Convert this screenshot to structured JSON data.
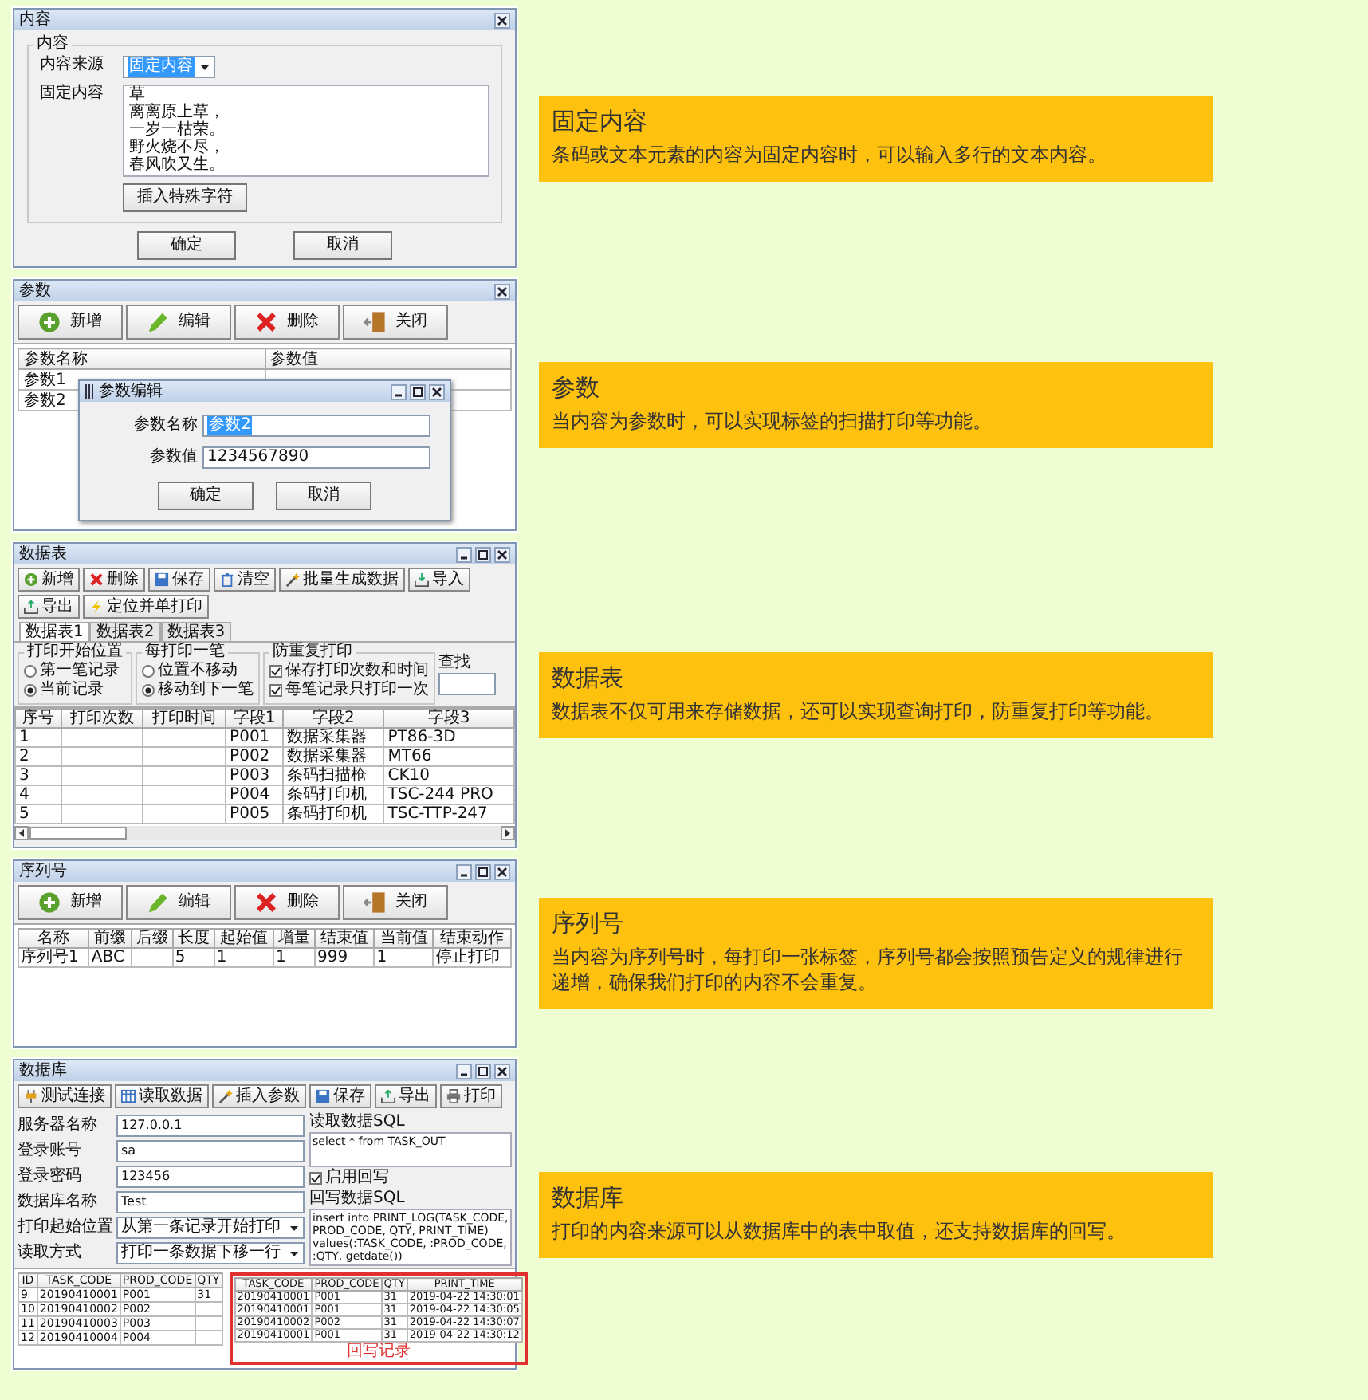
{
  "sections": [
    {
      "kind": "content",
      "window": {
        "title": "内容",
        "resizable": false,
        "group": "内容",
        "source_label": "内容来源",
        "source": {
          "value": "固定内容",
          "selected": true
        },
        "fixed_label": "固定内容",
        "lines": [
          "草",
          "离离原上草，",
          "一岁一枯荣。",
          "野火烧不尽，",
          "春风吹又生。"
        ],
        "insert_button": "插入特殊字符",
        "buttons": [
          "确定",
          "取消"
        ]
      },
      "info": {
        "title": "固定内容",
        "text": "条码或文本元素的内容为固定内容时，可以输入多行的文本内容。"
      }
    },
    {
      "kind": "params",
      "window": {
        "title": "参数",
        "resizable": false,
        "toolbar": [
          {
            "label": "新增",
            "kind": "add"
          },
          {
            "label": "编辑",
            "kind": "edit"
          },
          {
            "label": "删除",
            "kind": "delete"
          },
          {
            "label": "关闭",
            "kind": "close"
          }
        ],
        "columns": [
          "参数名称",
          "参数值"
        ],
        "rows": [
          [
            "参数1",
            ""
          ],
          [
            "参数2",
            ""
          ]
        ],
        "dialog": {
          "title": "参数编辑",
          "fields": [
            {
              "label": "参数名称",
              "value": "参数2",
              "selected": true
            },
            {
              "label": "参数值",
              "value": "1234567890",
              "selected": false
            }
          ],
          "buttons": [
            "确定",
            "取消"
          ]
        }
      },
      "info": {
        "title": "参数",
        "text": "当内容为参数时，可以实现标签的扫描打印等功能。"
      }
    },
    {
      "kind": "datatable",
      "window": {
        "title": "数据表",
        "resizable": true,
        "toolbar": [
          {
            "label": "新增",
            "kind": "add"
          },
          {
            "label": "删除",
            "kind": "delete"
          },
          {
            "label": "保存",
            "kind": "save"
          },
          {
            "label": "清空",
            "kind": "clear"
          },
          {
            "label": "批量生成数据",
            "kind": "generate"
          },
          {
            "label": "导入",
            "kind": "import"
          },
          {
            "label": "导出",
            "kind": "export"
          },
          {
            "label": "定位并单打印",
            "kind": "print"
          }
        ],
        "tabs": [
          {
            "label": "数据表1",
            "selected": true
          },
          {
            "label": "数据表2",
            "selected": false
          },
          {
            "label": "数据表3",
            "selected": false
          }
        ],
        "groups": [
          {
            "title": "打印开始位置",
            "options": [
              {
                "kind": "radio",
                "label": "第一笔记录",
                "checked": false
              },
              {
                "kind": "radio",
                "label": "当前记录",
                "checked": true
              }
            ]
          },
          {
            "title": "每打印一笔",
            "options": [
              {
                "kind": "radio",
                "label": "位置不移动",
                "checked": false
              },
              {
                "kind": "radio",
                "label": "移动到下一笔",
                "checked": true
              }
            ]
          },
          {
            "title": "防重复打印",
            "options": [
              {
                "kind": "checkbox",
                "label": "保存打印次数和时间",
                "checked": true
              },
              {
                "kind": "checkbox",
                "label": "每笔记录只打印一次",
                "checked": true
              }
            ]
          }
        ],
        "search_label": "查找",
        "columns": [
          "序号",
          "打印次数",
          "打印时间",
          "字段1",
          "字段2",
          "字段3"
        ],
        "rows": [
          [
            "1",
            "",
            "",
            "P001",
            "数据采集器",
            "PT86-3D"
          ],
          [
            "2",
            "",
            "",
            "P002",
            "数据采集器",
            "MT66"
          ],
          [
            "3",
            "",
            "",
            "P003",
            "条码扫描枪",
            "CK10"
          ],
          [
            "4",
            "",
            "",
            "P004",
            "条码打印机",
            "TSC-244 PRO"
          ],
          [
            "5",
            "",
            "",
            "P005",
            "条码打印机",
            "TSC-TTP-247"
          ]
        ]
      },
      "info": {
        "title": "数据表",
        "text": "数据表不仅可用来存储数据，还可以实现查询打印，防重复打印等功能。"
      }
    },
    {
      "kind": "serial",
      "window": {
        "title": "序列号",
        "resizable": true,
        "toolbar": [
          {
            "label": "新增",
            "kind": "add"
          },
          {
            "label": "编辑",
            "kind": "edit"
          },
          {
            "label": "删除",
            "kind": "delete"
          },
          {
            "label": "关闭",
            "kind": "close"
          }
        ],
        "columns": [
          "名称",
          "前缀",
          "后缀",
          "长度",
          "起始值",
          "增量",
          "结束值",
          "当前值",
          "结束动作"
        ],
        "rows": [
          [
            "序列号1",
            "ABC",
            "",
            "5",
            "1",
            "1",
            "999",
            "1",
            "停止打印"
          ]
        ]
      },
      "info": {
        "title": "序列号",
        "text": "当内容为序列号时，每打印一张标签，序列号都会按照预告定义的规律进行递增，确保我们打印的内容不会重复。"
      }
    },
    {
      "kind": "database",
      "window": {
        "title": "数据库",
        "resizable": true,
        "toolbar": [
          {
            "label": "测试连接",
            "kind": "connect"
          },
          {
            "label": "读取数据",
            "kind": "read"
          },
          {
            "label": "插入参数",
            "kind": "generate"
          },
          {
            "label": "保存",
            "kind": "save"
          },
          {
            "label": "导出",
            "kind": "export"
          },
          {
            "label": "打印",
            "kind": "printer"
          }
        ],
        "fields": [
          {
            "label": "服务器名称",
            "value": "127.0.0.1"
          },
          {
            "label": "登录账号",
            "value": "sa"
          },
          {
            "label": "登录密码",
            "value": "123456"
          },
          {
            "label": "数据库名称",
            "value": "Test"
          }
        ],
        "selects": [
          {
            "label": "打印起始位置",
            "value": "从第一条记录开始打印"
          },
          {
            "label": "读取方式",
            "value": "打印一条数据下移一行"
          }
        ],
        "read_sql_label": "读取数据SQL",
        "read_sql": "select * from TASK_OUT",
        "writeback": {
          "label": "启用回写",
          "checked": true
        },
        "write_sql_label": "回写数据SQL",
        "write_sql": "insert into PRINT_LOG(TASK_CODE, PROD_CODE, QTY, PRINT_TIME) values(:TASK_CODE, :PROD_CODE, :QTY, getdate())",
        "columns": [
          "ID",
          "TASK_CODE",
          "PROD_CODE",
          "QTY"
        ],
        "rows": [
          [
            "9",
            "20190410001",
            "P001",
            "31"
          ],
          [
            "10",
            "20190410002",
            "P002",
            ""
          ],
          [
            "11",
            "20190410003",
            "P003",
            ""
          ],
          [
            "12",
            "20190410004",
            "P004",
            ""
          ]
        ],
        "log": {
          "columns": [
            "TASK_CODE",
            "PROD_CODE",
            "QTY",
            "PRINT_TIME"
          ],
          "rows": [
            [
              "20190410001",
              "P001",
              "31",
              "2019-04-22 14:30:01"
            ],
            [
              "20190410001",
              "P001",
              "31",
              "2019-04-22 14:30:05"
            ],
            [
              "20190410002",
              "P002",
              "31",
              "2019-04-22 14:30:07"
            ],
            [
              "20190410001",
              "P001",
              "31",
              "2019-04-22 14:30:12"
            ]
          ],
          "caption": "回写记录"
        }
      },
      "info": {
        "title": "数据库",
        "text": "打印的内容来源可以从数据库中的表中取值，还支持数据库的回写。"
      }
    }
  ]
}
